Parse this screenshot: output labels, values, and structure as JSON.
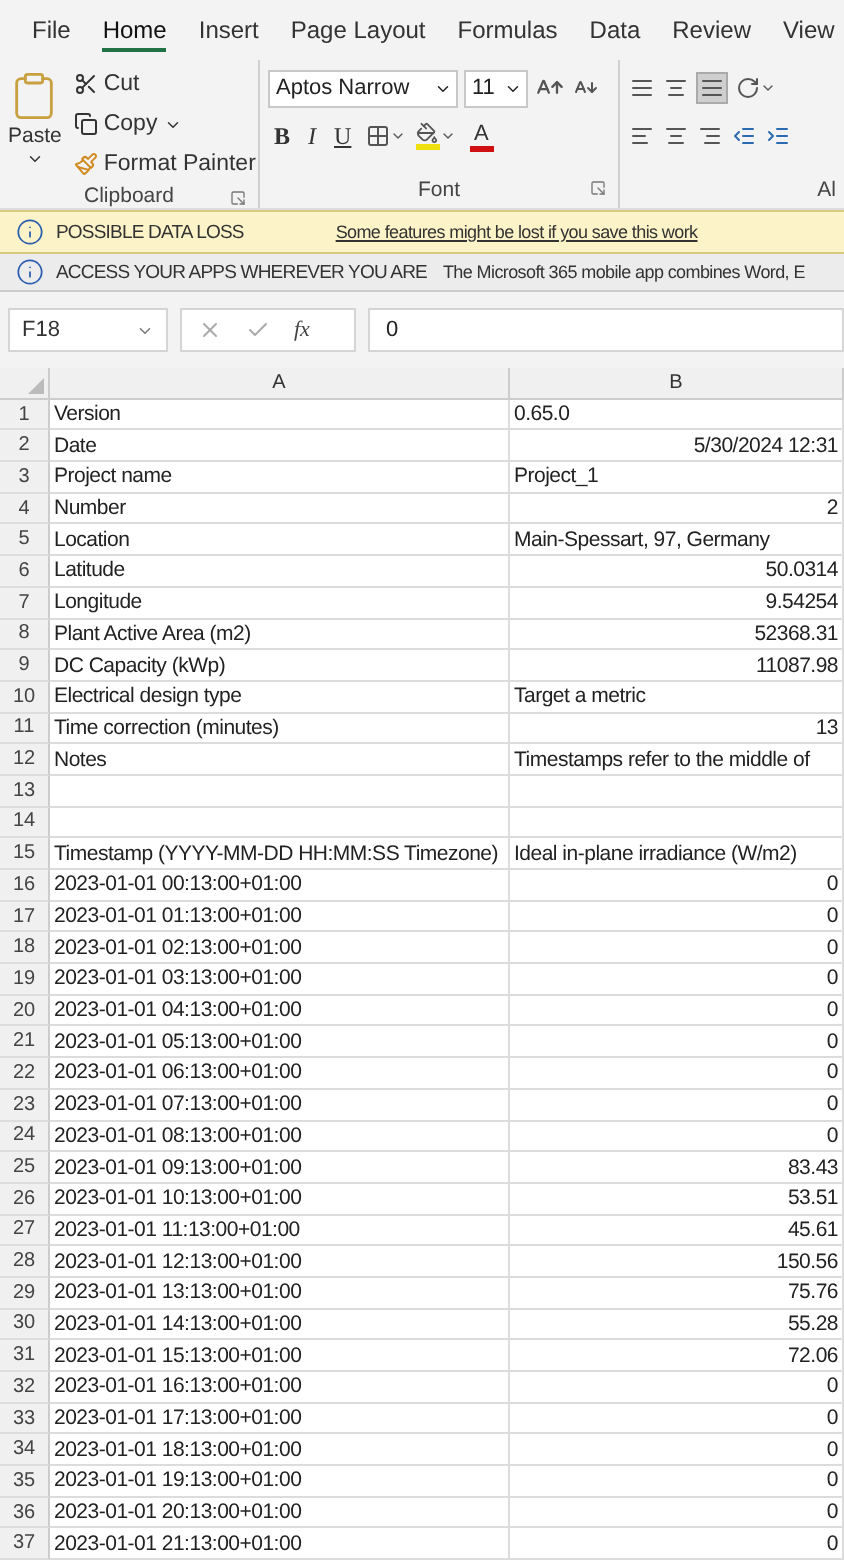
{
  "menu_tabs": [
    {
      "label": "File",
      "selected": false
    },
    {
      "label": "Home",
      "selected": true
    },
    {
      "label": "Insert",
      "selected": false
    },
    {
      "label": "Page Layout",
      "selected": false
    },
    {
      "label": "Formulas",
      "selected": false
    },
    {
      "label": "Data",
      "selected": false
    },
    {
      "label": "Review",
      "selected": false
    },
    {
      "label": "View",
      "selected": false
    }
  ],
  "ribbon": {
    "clipboard": {
      "paste": "Paste",
      "cut": "Cut",
      "copy": "Copy",
      "format_painter": "Format Painter",
      "label": "Clipboard"
    },
    "font": {
      "font_name": "Aptos Narrow",
      "font_size": "11",
      "bold": "B",
      "italic": "I",
      "underline": "U",
      "font_color": "A",
      "label": "Font"
    },
    "alignment": {
      "label": "Al"
    }
  },
  "notices": [
    {
      "kind": "warning",
      "title": "POSSIBLE DATA LOSS",
      "message": "Some features might be lost if you save this work"
    },
    {
      "kind": "info",
      "title": "ACCESS YOUR APPS WHEREVER YOU ARE",
      "message": "The Microsoft 365 mobile app combines Word, E"
    }
  ],
  "formula_bar": {
    "cell_ref": "F18",
    "function_label": "fx",
    "value": "0"
  },
  "columns": [
    "A",
    "B"
  ],
  "rows": [
    {
      "n": "1",
      "a": "Version",
      "b": "0.65.0",
      "kind": "text"
    },
    {
      "n": "2",
      "a": "Date",
      "b": "5/30/2024 12:31",
      "kind": "number"
    },
    {
      "n": "3",
      "a": "Project name",
      "b": "Project_1",
      "kind": "text"
    },
    {
      "n": "4",
      "a": "Number",
      "b": "2",
      "kind": "number"
    },
    {
      "n": "5",
      "a": "Location",
      "b": "Main-Spessart, 97, Germany",
      "kind": "text"
    },
    {
      "n": "6",
      "a": "Latitude",
      "b": "50.0314",
      "kind": "number"
    },
    {
      "n": "7",
      "a": "Longitude",
      "b": "9.54254",
      "kind": "number"
    },
    {
      "n": "8",
      "a": "Plant Active Area (m2)",
      "b": "52368.31",
      "kind": "number"
    },
    {
      "n": "9",
      "a": "DC Capacity (kWp)",
      "b": "11087.98",
      "kind": "number"
    },
    {
      "n": "10",
      "a": "Electrical design type",
      "b": "Target a metric",
      "kind": "text"
    },
    {
      "n": "11",
      "a": "Time correction (minutes)",
      "b": "13",
      "kind": "number"
    },
    {
      "n": "12",
      "a": "Notes",
      "b": "Timestamps refer to the middle of",
      "kind": "text"
    },
    {
      "n": "13",
      "kind": "text"
    },
    {
      "n": "14",
      "kind": "text"
    },
    {
      "n": "15",
      "a": "Timestamp (YYYY-MM-DD HH:MM:SS Timezone)",
      "b": "Ideal in-plane irradiance (W/m2)",
      "kind": "text"
    },
    {
      "n": "16",
      "a": "2023-01-01 00:13:00+01:00",
      "b": "0",
      "kind": "number"
    },
    {
      "n": "17",
      "a": "2023-01-01 01:13:00+01:00",
      "b": "0",
      "kind": "number"
    },
    {
      "n": "18",
      "a": "2023-01-01 02:13:00+01:00",
      "b": "0",
      "kind": "number"
    },
    {
      "n": "19",
      "a": "2023-01-01 03:13:00+01:00",
      "b": "0",
      "kind": "number"
    },
    {
      "n": "20",
      "a": "2023-01-01 04:13:00+01:00",
      "b": "0",
      "kind": "number"
    },
    {
      "n": "21",
      "a": "2023-01-01 05:13:00+01:00",
      "b": "0",
      "kind": "number"
    },
    {
      "n": "22",
      "a": "2023-01-01 06:13:00+01:00",
      "b": "0",
      "kind": "number"
    },
    {
      "n": "23",
      "a": "2023-01-01 07:13:00+01:00",
      "b": "0",
      "kind": "number"
    },
    {
      "n": "24",
      "a": "2023-01-01 08:13:00+01:00",
      "b": "0",
      "kind": "number"
    },
    {
      "n": "25",
      "a": "2023-01-01 09:13:00+01:00",
      "b": "83.43",
      "kind": "number"
    },
    {
      "n": "26",
      "a": "2023-01-01 10:13:00+01:00",
      "b": "53.51",
      "kind": "number"
    },
    {
      "n": "27",
      "a": "2023-01-01 11:13:00+01:00",
      "b": "45.61",
      "kind": "number"
    },
    {
      "n": "28",
      "a": "2023-01-01 12:13:00+01:00",
      "b": "150.56",
      "kind": "number"
    },
    {
      "n": "29",
      "a": "2023-01-01 13:13:00+01:00",
      "b": "75.76",
      "kind": "number"
    },
    {
      "n": "30",
      "a": "2023-01-01 14:13:00+01:00",
      "b": "55.28",
      "kind": "number"
    },
    {
      "n": "31",
      "a": "2023-01-01 15:13:00+01:00",
      "b": "72.06",
      "kind": "number"
    },
    {
      "n": "32",
      "a": "2023-01-01 16:13:00+01:00",
      "b": "0",
      "kind": "number"
    },
    {
      "n": "33",
      "a": "2023-01-01 17:13:00+01:00",
      "b": "0",
      "kind": "number"
    },
    {
      "n": "34",
      "a": "2023-01-01 18:13:00+01:00",
      "b": "0",
      "kind": "number"
    },
    {
      "n": "35",
      "a": "2023-01-01 19:13:00+01:00",
      "b": "0",
      "kind": "number"
    },
    {
      "n": "36",
      "a": "2023-01-01 20:13:00+01:00",
      "b": "0",
      "kind": "number"
    },
    {
      "n": "37",
      "a": "2023-01-01 21:13:00+01:00",
      "b": "0",
      "kind": "number"
    }
  ]
}
